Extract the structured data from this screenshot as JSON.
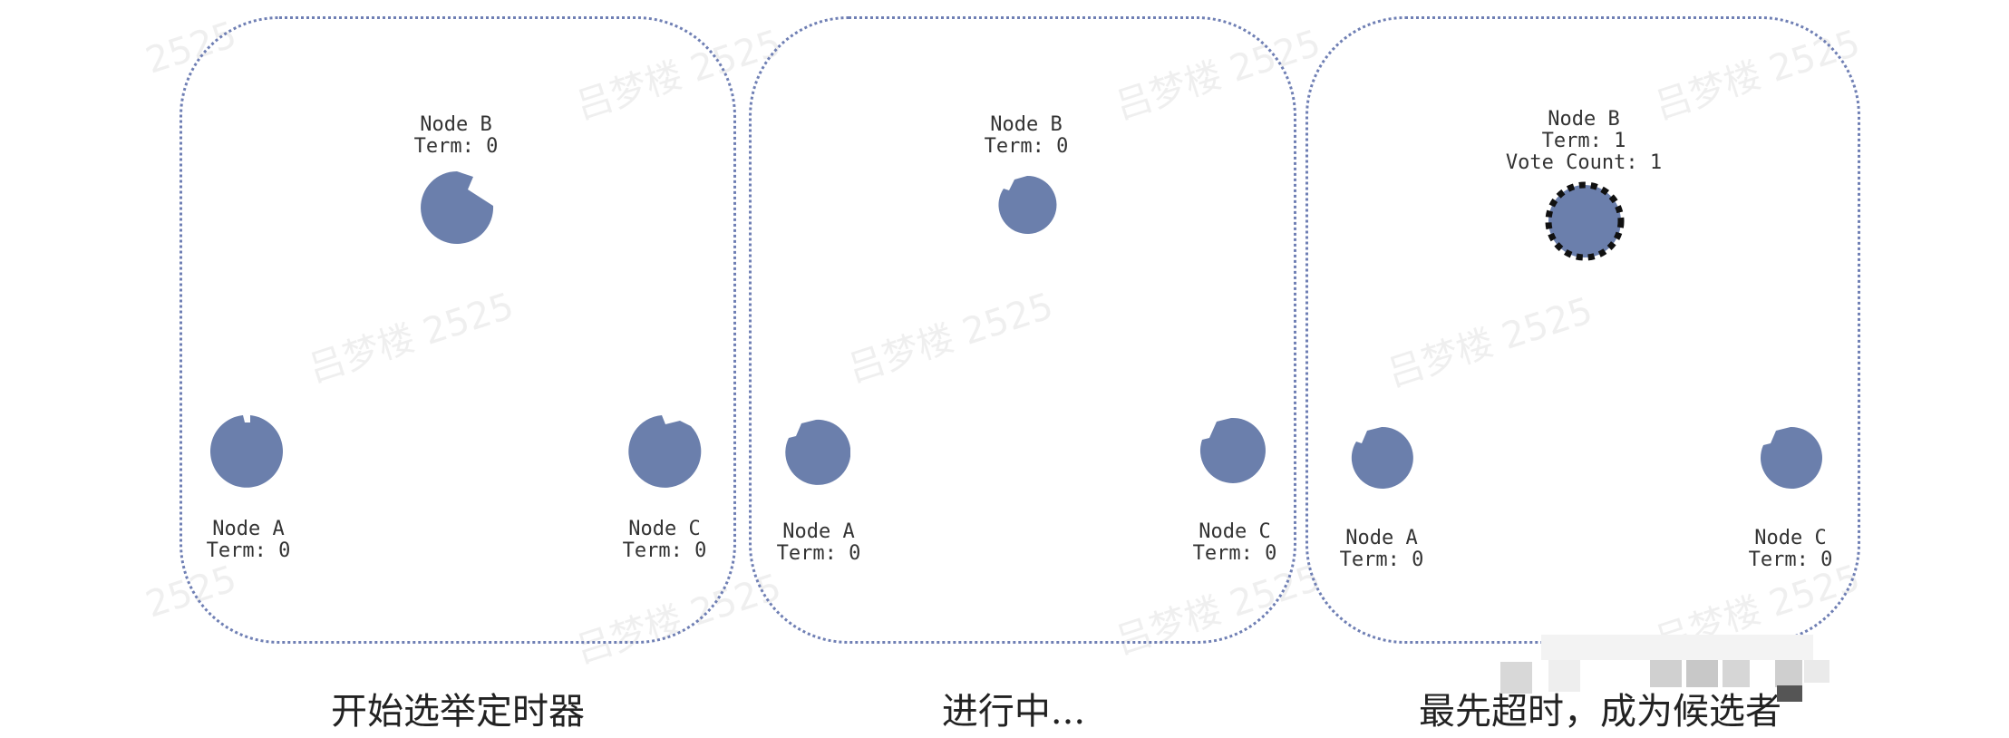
{
  "panels": [
    {
      "caption": "开始选举定时器",
      "nodes": {
        "b": {
          "name": "Node B",
          "term": "Term: 0"
        },
        "a": {
          "name": "Node A",
          "term": "Term: 0"
        },
        "c": {
          "name": "Node C",
          "term": "Term: 0"
        }
      }
    },
    {
      "caption": "进行中...",
      "nodes": {
        "b": {
          "name": "Node B",
          "term": "Term: 0"
        },
        "a": {
          "name": "Node A",
          "term": "Term: 0"
        },
        "c": {
          "name": "Node C",
          "term": "Term: 0"
        }
      }
    },
    {
      "caption": "最先超时，成为候选者",
      "nodes": {
        "b": {
          "name": "Node B",
          "term": "Term: 1",
          "votes": "Vote Count: 1"
        },
        "a": {
          "name": "Node A",
          "term": "Term: 0"
        },
        "c": {
          "name": "Node C",
          "term": "Term: 0"
        }
      }
    }
  ],
  "watermark": {
    "text": "吕梦楼 2525",
    "short": "2525"
  },
  "colors": {
    "node_fill": "#6b7fac",
    "panel_border": "#6f7fb4",
    "candidate_border": "#111111"
  }
}
